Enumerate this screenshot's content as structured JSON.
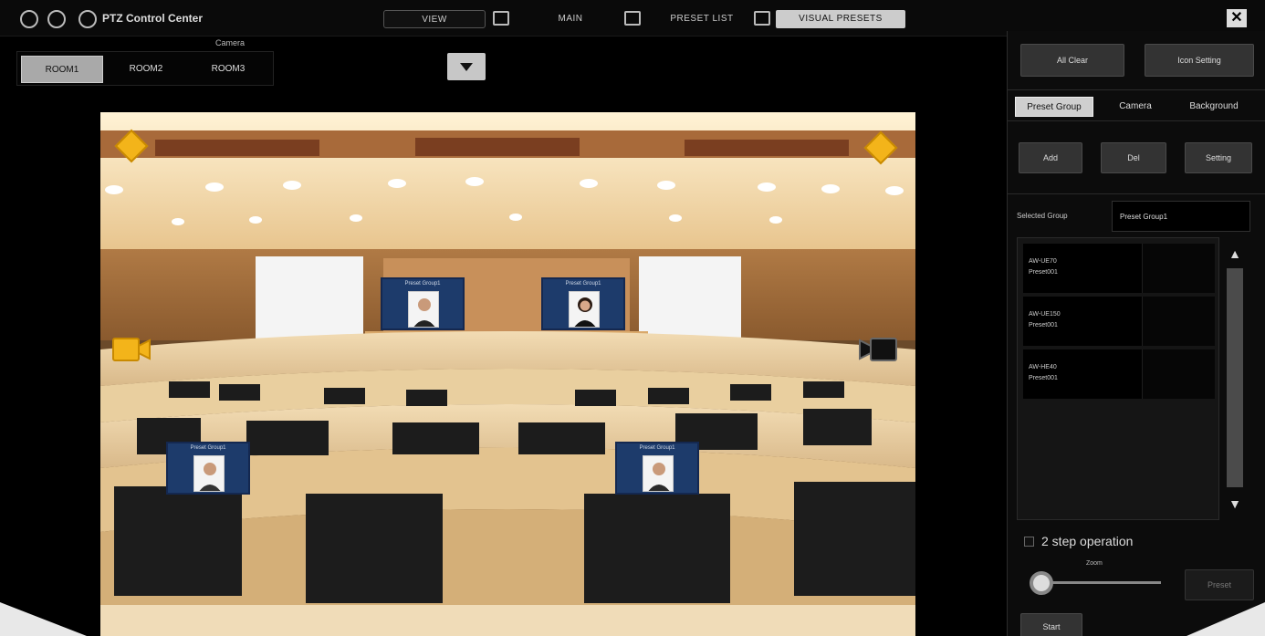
{
  "app": {
    "title": "PTZ Control Center",
    "close_label": "✕"
  },
  "tabs": [
    {
      "label": "VIEW"
    },
    {
      "label": "MAIN"
    },
    {
      "label": "PRESET LIST"
    },
    {
      "label": "VISUAL PRESETS"
    }
  ],
  "camera_group": {
    "label": "Camera",
    "rooms": [
      {
        "label": "ROOM1",
        "active": true
      },
      {
        "label": "ROOM2",
        "active": false
      },
      {
        "label": "ROOM3",
        "active": false
      }
    ]
  },
  "preset_cards": [
    {
      "label": "Preset Group1"
    },
    {
      "label": "Preset Group1"
    },
    {
      "label": "Preset Group1"
    },
    {
      "label": "Preset Group1"
    }
  ],
  "right_panel": {
    "all_clear_label": "All Clear",
    "icon_setting_label": "Icon Setting",
    "sub_tabs": [
      {
        "label": "Preset Group",
        "active": true
      },
      {
        "label": "Camera",
        "active": false
      },
      {
        "label": "Background",
        "active": false
      }
    ],
    "add_label": "Add",
    "del_label": "Del",
    "setting_label": "Setting",
    "selected_group_label": "Selected Group",
    "selected_group_value": "Preset Group1",
    "preset_items": [
      {
        "line1": "AW-UE70",
        "line2": "Preset001"
      },
      {
        "line1": "AW-UE150",
        "line2": "Preset001"
      },
      {
        "line1": "AW-HE40",
        "line2": "Preset001"
      }
    ],
    "two_step_label": "2 step operation",
    "slider_label": "Zoom",
    "preset_button_label": "Preset",
    "start_label": "Start"
  },
  "colors": {
    "background": "#000000",
    "card_blue": "#1d3b6b",
    "icon_yellow": "#f3b41a"
  }
}
